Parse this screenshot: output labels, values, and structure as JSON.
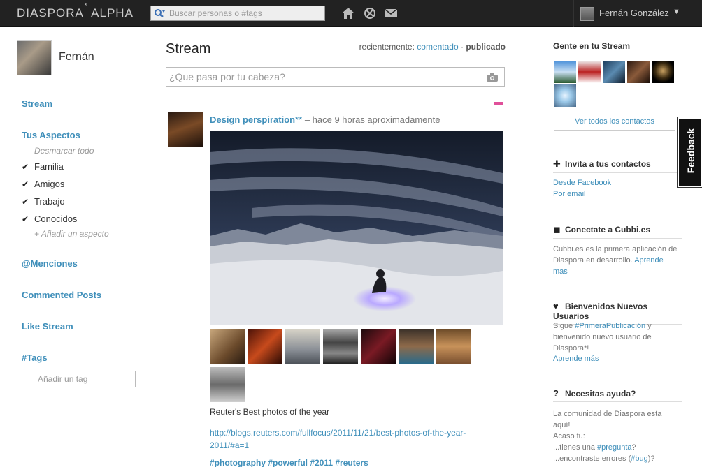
{
  "header": {
    "logo": "DIASPORA",
    "logo_sup": "*",
    "logo_suffix": " ALPHA",
    "search_placeholder": "Buscar personas o #tags",
    "user_name": "Fernán González",
    "caret": "▼"
  },
  "left": {
    "profile_name": "Fernán",
    "nav_stream": "Stream",
    "aspects_title": "Tus Aspectos",
    "deselect_all": "Desmarcar todo",
    "aspects": [
      "Familia",
      "Amigos",
      "Trabajo",
      "Conocidos"
    ],
    "add_aspect": "+ Añadir un aspecto",
    "mentions": "@Menciones",
    "commented": "Commented Posts",
    "like_stream": "Like Stream",
    "tags": "#Tags",
    "tag_placeholder": "Añadir un tag"
  },
  "main": {
    "title": "Stream",
    "sort_prefix": "recientemente: ",
    "sort_commented": "comentado",
    "sort_sep": " · ",
    "sort_published": "publicado",
    "publisher_placeholder": "¿Que pasa por tu cabeza?",
    "post": {
      "author": "Design perspiration",
      "author_stars": "**",
      "time": " – hace 9 horas aproximadamente",
      "caption": "Reuter's Best photos of the year",
      "link": "http://blogs.reuters.com/fullfocus/2011/11/21/best-photos-of-the-year-2011/#a=1",
      "tags": "#photography #powerful #2011 #reuters"
    }
  },
  "right": {
    "people_title": "Gente en tu Stream",
    "see_all": "Ver todos los contactos",
    "invite_title": "Invita a tus contactos",
    "from_facebook": "Desde Facebook",
    "by_email": "Por email",
    "cubbi_title": "Conectate a Cubbi.es",
    "cubbi_text": "Cubbi.es es la primera aplicación de Diaspora en desarrollo. ",
    "cubbi_link": "Aprende mas",
    "welcome_title": "Bienvenidos Nuevos Usuarios",
    "welcome_text_1": "Sigue ",
    "welcome_tag": "#PrimeraPublicación",
    "welcome_text_2": " y bienvenido nuevo usuario de Diaspora*!",
    "welcome_link": "Aprende más",
    "help_title": "Necesitas ayuda?",
    "help_text_1": "La comunidad de Diaspora esta aquí!",
    "help_text_2": "Acaso tu:",
    "help_q1_a": "...tienes una ",
    "help_q1_tag": "#pregunta",
    "help_q1_b": "?",
    "help_q2_a": "...encontraste errores (",
    "help_q2_tag": "#bug",
    "help_q2_b": ")?",
    "feedback": "Feedback"
  },
  "colors": {
    "link": "#3f8fba",
    "header_bg": "#222222",
    "accent_pink": "#e0509a"
  },
  "icons": [
    "search-icon",
    "home-icon",
    "notifications-icon",
    "mail-icon",
    "camera-icon",
    "plus-icon",
    "cube-icon",
    "heart-icon",
    "question-icon",
    "check-icon"
  ]
}
